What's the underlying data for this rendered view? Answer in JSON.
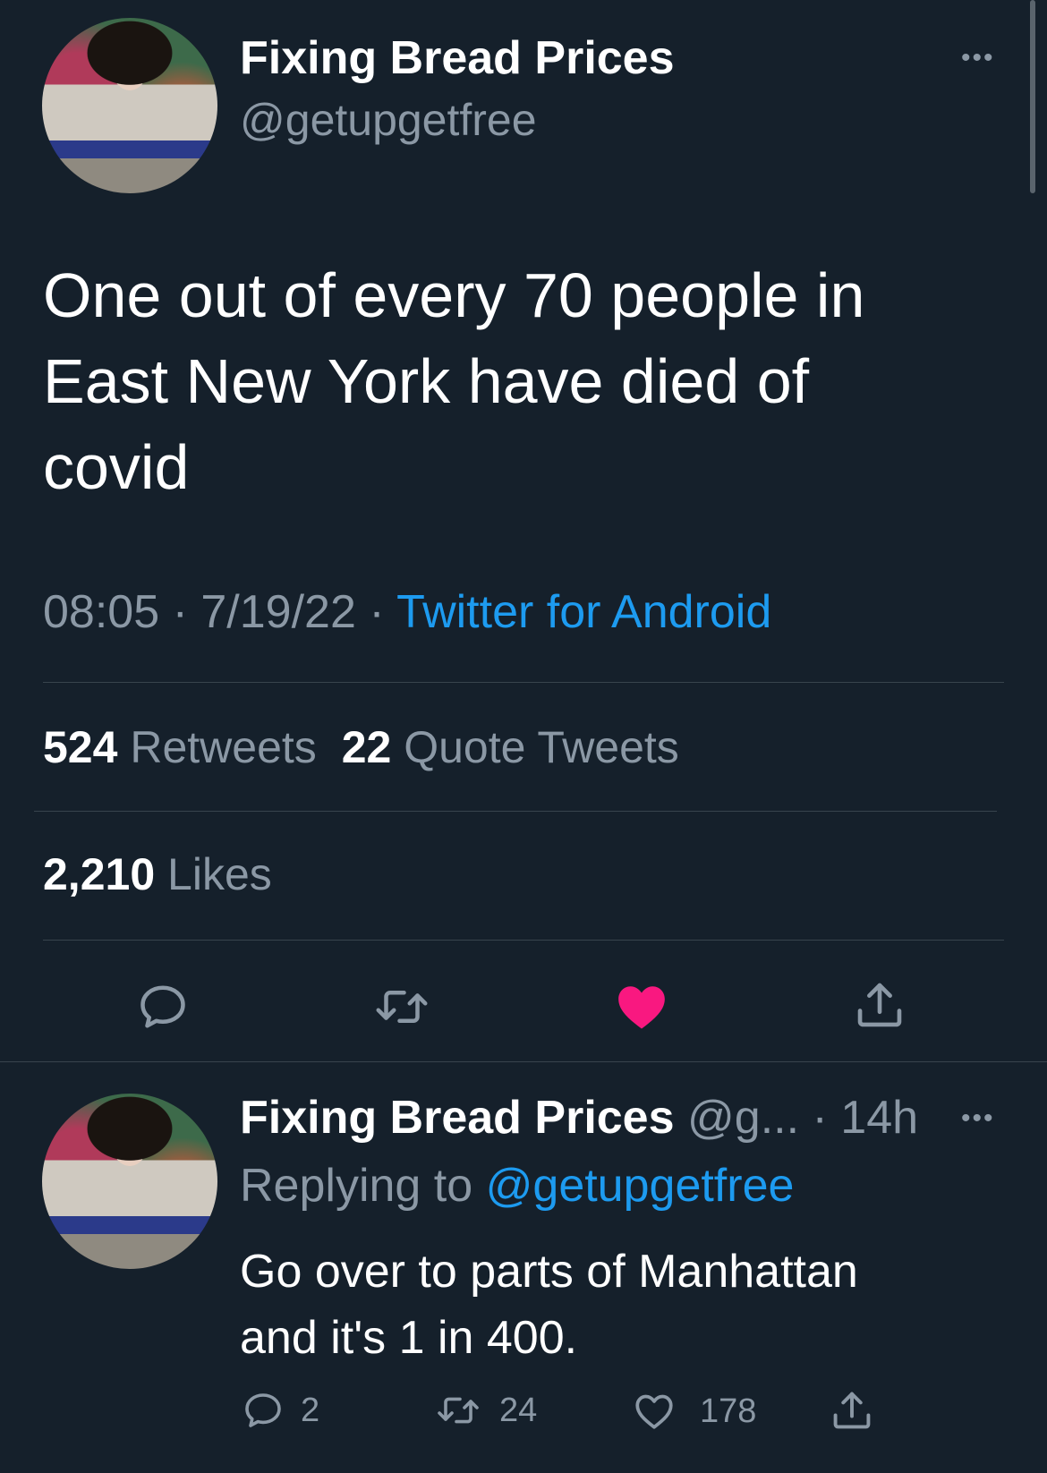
{
  "tweet": {
    "author_name": "Fixing Bread Prices",
    "handle": "@getupgetfree",
    "text_line1": "One out of every 70 people in",
    "text_line2": "East New York have died of",
    "text_line3": "covid",
    "time": "08:05",
    "sep1": "·",
    "date": "7/19/22",
    "sep2": "·",
    "source": "Twitter for Android",
    "retweets_count": "524",
    "retweets_label": "Retweets",
    "quotes_count": "22",
    "quotes_label": "Quote Tweets",
    "likes_count": "2,210",
    "likes_label": "Likes",
    "more": "•••",
    "actions": {
      "reply_icon": "reply-icon",
      "retweet_icon": "retweet-icon",
      "like_icon": "heart-filled-icon",
      "share_icon": "share-icon",
      "liked_color": "#f91880"
    }
  },
  "reply": {
    "author_name": "Fixing Bread Prices",
    "handle": "@g...",
    "sep": "·",
    "age": "14h",
    "more": "•••",
    "replying_prefix": "Replying to",
    "replying_handle": "@getupgetfree",
    "text_line1": "Go over to parts of Manhattan",
    "text_line2": "and it's 1 in 400.",
    "reply_count": "2",
    "retweet_count": "24",
    "like_count": "178"
  },
  "colors": {
    "background": "#15202b",
    "text": "#ffffff",
    "muted": "#8b98a5",
    "accent": "#1d9bf0",
    "like": "#f91880"
  }
}
